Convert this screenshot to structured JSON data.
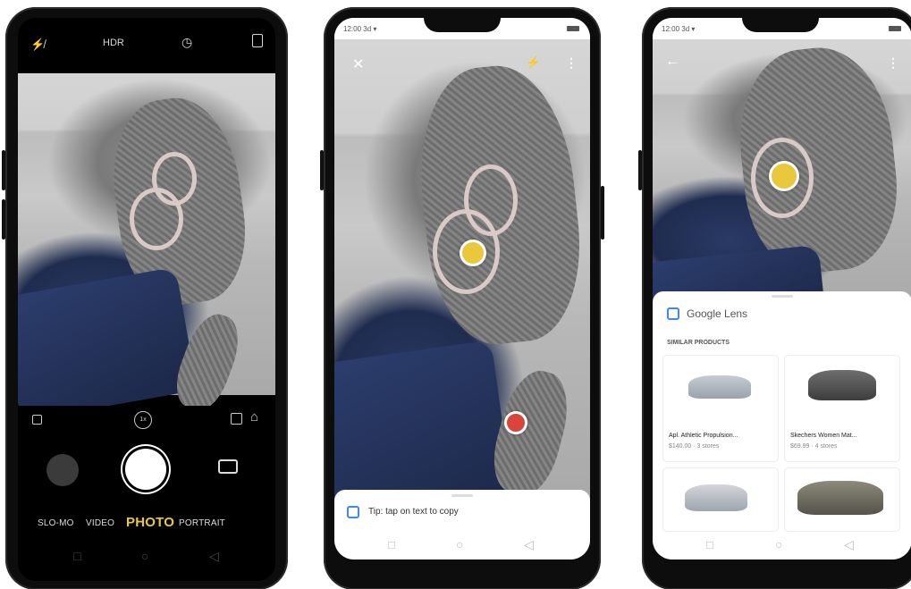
{
  "phone1": {
    "top_bar": {
      "hdr_label": "HDR"
    },
    "zoom_label": "1x",
    "modes": [
      "SLO-MO",
      "VIDEO",
      "PHOTO",
      "PORTRAIT"
    ],
    "active_mode": "PHOTO"
  },
  "phone2": {
    "status_time": "12:00 3d ▾",
    "tip_text": "Tip: tap on text to copy"
  },
  "phone3": {
    "status_time": "12:00 3d ▾",
    "brand": "Google Lens",
    "section_title": "SIMILAR PRODUCTS",
    "products": [
      {
        "name": "Apl. Athletic Propulsion...",
        "meta": "$140.00 · 3 stores"
      },
      {
        "name": "Skechers Women Mat...",
        "meta": "$69.99 · 4 stores"
      }
    ]
  },
  "colors": {
    "accent_yellow": "#e9c83b",
    "record_red": "#d9453b"
  },
  "icons": [
    "flash-off-icon",
    "timer-icon",
    "aspect-ratio-icon",
    "gallery-thumbnail",
    "shutter-button",
    "switch-camera-icon",
    "lens-icon",
    "close-icon",
    "more-icon",
    "back-icon",
    "recent-apps-icon",
    "home-icon",
    "back-nav-icon"
  ]
}
